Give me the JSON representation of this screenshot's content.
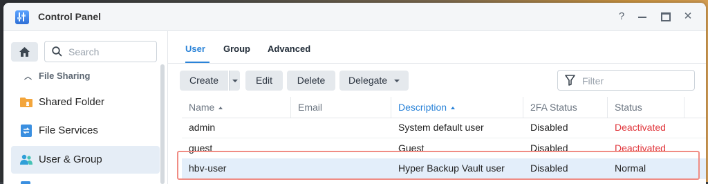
{
  "window": {
    "title": "Control Panel"
  },
  "controls": {
    "help": "?",
    "close": "✕"
  },
  "sidebar": {
    "search_placeholder": "Search",
    "section": "File Sharing",
    "items": [
      {
        "label": "Shared Folder",
        "icon": "folder-icon"
      },
      {
        "label": "File Services",
        "icon": "file-services-icon"
      },
      {
        "label": "User & Group",
        "icon": "users-icon",
        "active": true
      }
    ]
  },
  "tabs": [
    {
      "label": "User",
      "active": true
    },
    {
      "label": "Group"
    },
    {
      "label": "Advanced"
    }
  ],
  "toolbar": {
    "create": "Create",
    "edit": "Edit",
    "delete": "Delete",
    "delegate": "Delegate",
    "filter_placeholder": "Filter"
  },
  "table": {
    "columns": [
      "Name",
      "Email",
      "Description",
      "2FA Status",
      "Status"
    ],
    "sorted_column": "Description",
    "rows": [
      {
        "name": "admin",
        "email": "",
        "description": "System default user",
        "twofa": "Disabled",
        "status": "Deactivated"
      },
      {
        "name": "guest",
        "email": "",
        "description": "Guest",
        "twofa": "Disabled",
        "status": "Deactivated"
      },
      {
        "name": "hbv-user",
        "email": "",
        "description": "Hyper Backup Vault user",
        "twofa": "Disabled",
        "status": "Normal",
        "selected": true
      }
    ]
  },
  "colors": {
    "accent": "#2a83d8",
    "deactivated": "#e0343a",
    "highlight_border": "#f08c84"
  }
}
